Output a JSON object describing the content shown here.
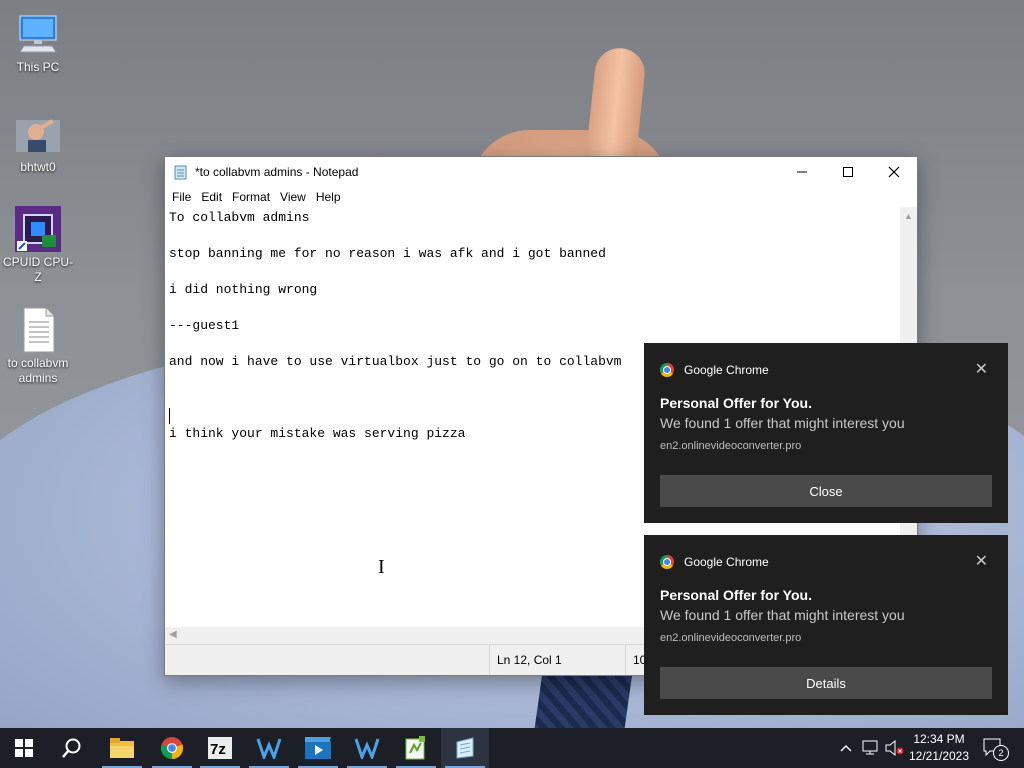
{
  "desktop": {
    "icons": [
      {
        "label": "This PC",
        "icon": "computer-icon"
      },
      {
        "label": "bhtwt0",
        "icon": "user-photo-icon"
      },
      {
        "label": "CPUID CPU-Z",
        "icon": "cpu-z-icon"
      },
      {
        "label": "to collabvm admins",
        "icon": "text-file-icon"
      }
    ]
  },
  "notepad": {
    "title": "*to collabvm admins - Notepad",
    "menu": [
      "File",
      "Edit",
      "Format",
      "View",
      "Help"
    ],
    "lines": [
      "To collabvm admins",
      "",
      "stop banning me for no reason i was afk and i got banned",
      "",
      "i did nothing wrong",
      "",
      "---guest1",
      "",
      "and now i have to use virtualbox just to go on to collabvm",
      "",
      "",
      "",
      "i think your mistake was serving pizza"
    ],
    "caret_line": 12,
    "status": {
      "position": "Ln 12, Col 1",
      "zoom_partial": "10"
    }
  },
  "notifications": [
    {
      "app": "Google Chrome",
      "title": "Personal Offer for You.",
      "body": "We found 1 offer that might interest you",
      "url": "en2.onlinevideoconverter.pro",
      "button": "Close"
    },
    {
      "app": "Google Chrome",
      "title": "Personal Offer for You.",
      "body": "We found 1 offer that might interest you",
      "url": "en2.onlinevideoconverter.pro",
      "button": "Details"
    }
  ],
  "taskbar": {
    "apps": [
      "start-icon",
      "search-icon",
      "file-explorer-icon",
      "chrome-icon",
      "7zip-icon",
      "vmware-icon",
      "movie-maker-icon",
      "vmware-icon",
      "notepadpp-icon",
      "notepad-icon"
    ],
    "clock": {
      "time": "12:34 PM",
      "date": "12/21/2023"
    },
    "notification_count": "2"
  },
  "colors": {
    "taskbar": "#1c1f26",
    "toast_bg": "#1f1f1f",
    "toast_button": "#4a4a4a"
  }
}
